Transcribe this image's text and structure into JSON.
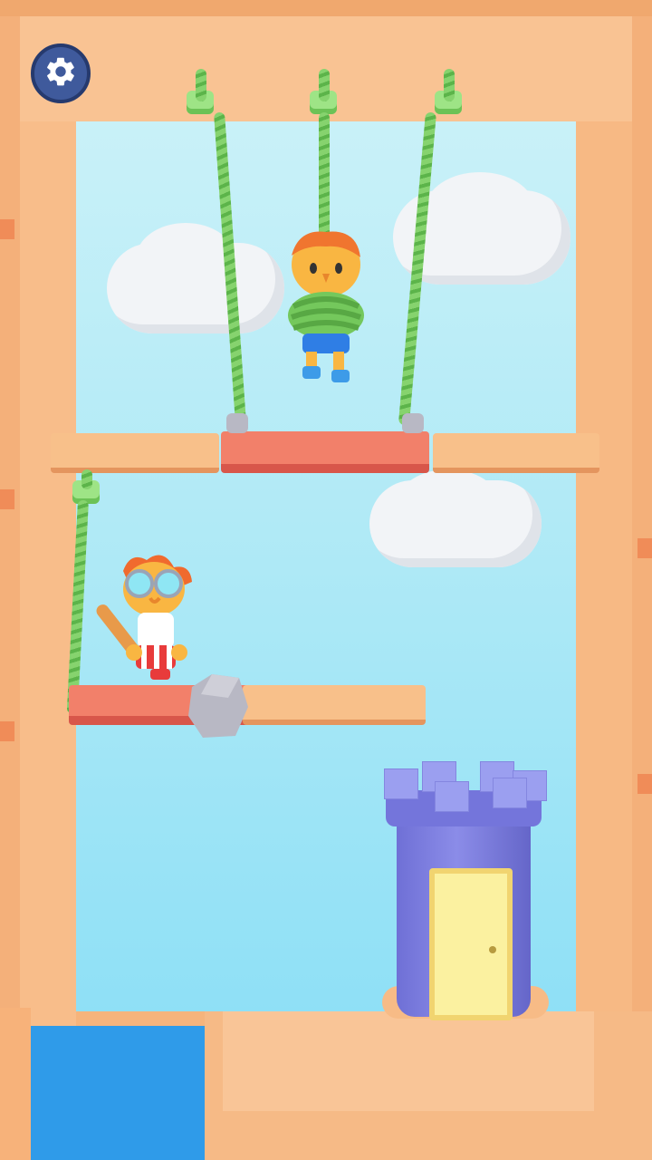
{
  "screen": "rope-rescue-level",
  "hud": {
    "settings_icon": "gear-icon"
  },
  "colors": {
    "frame": "#f6b47c",
    "sky_top": "#c9f1f8",
    "sky_bottom": "#8fe0f6",
    "rope": "#6cc256",
    "pin": "#f2806a",
    "tower": "#7475db",
    "door": "#fbf1a0",
    "water": "#2f9be9",
    "settings_button": "#3f5a9c"
  },
  "characters": [
    {
      "role": "hostage",
      "description_icon": "tied-boy-icon"
    },
    {
      "role": "enemy",
      "description_icon": "bat-villain-icon"
    }
  ],
  "objects": {
    "ropes": 4,
    "pins": 2,
    "tower": "castle-tower-icon",
    "boulder": "boulder-icon"
  }
}
